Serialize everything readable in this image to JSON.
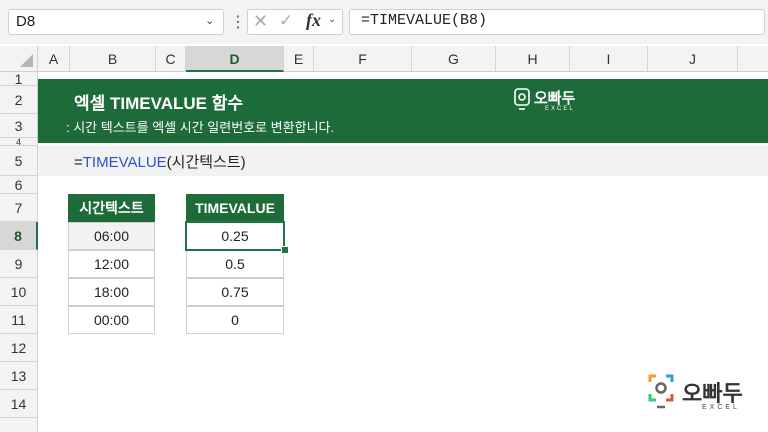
{
  "namebox": {
    "value": "D8"
  },
  "formula_bar": {
    "fx_label": "fx",
    "formula": "=TIMEVALUE(B8)"
  },
  "columns": [
    "A",
    "B",
    "C",
    "D",
    "E",
    "F",
    "G",
    "H",
    "I",
    "J"
  ],
  "selected_column": "D",
  "rows": [
    "1",
    "2",
    "3",
    "4",
    "5",
    "6",
    "7",
    "8",
    "9",
    "10",
    "11",
    "12",
    "13",
    "14"
  ],
  "selected_row": "8",
  "banner": {
    "title": "엑셀 TIMEVALUE 함수",
    "subtitle": ": 시간 텍스트를 엑셀 시간 일련번호로 변환합니다.",
    "color": "#1e6b3a"
  },
  "syntax": {
    "prefix": "=",
    "function": "TIMEVALUE",
    "args": "(시간텍스트)"
  },
  "table_left": {
    "header": "시간텍스트",
    "values": [
      "06:00",
      "12:00",
      "18:00",
      "00:00"
    ]
  },
  "table_right": {
    "header": "TIMEVALUE",
    "values": [
      "0.25",
      "0.5",
      "0.75",
      "0"
    ]
  },
  "brand": {
    "name": "오빠두",
    "sub": "EXCEL"
  }
}
